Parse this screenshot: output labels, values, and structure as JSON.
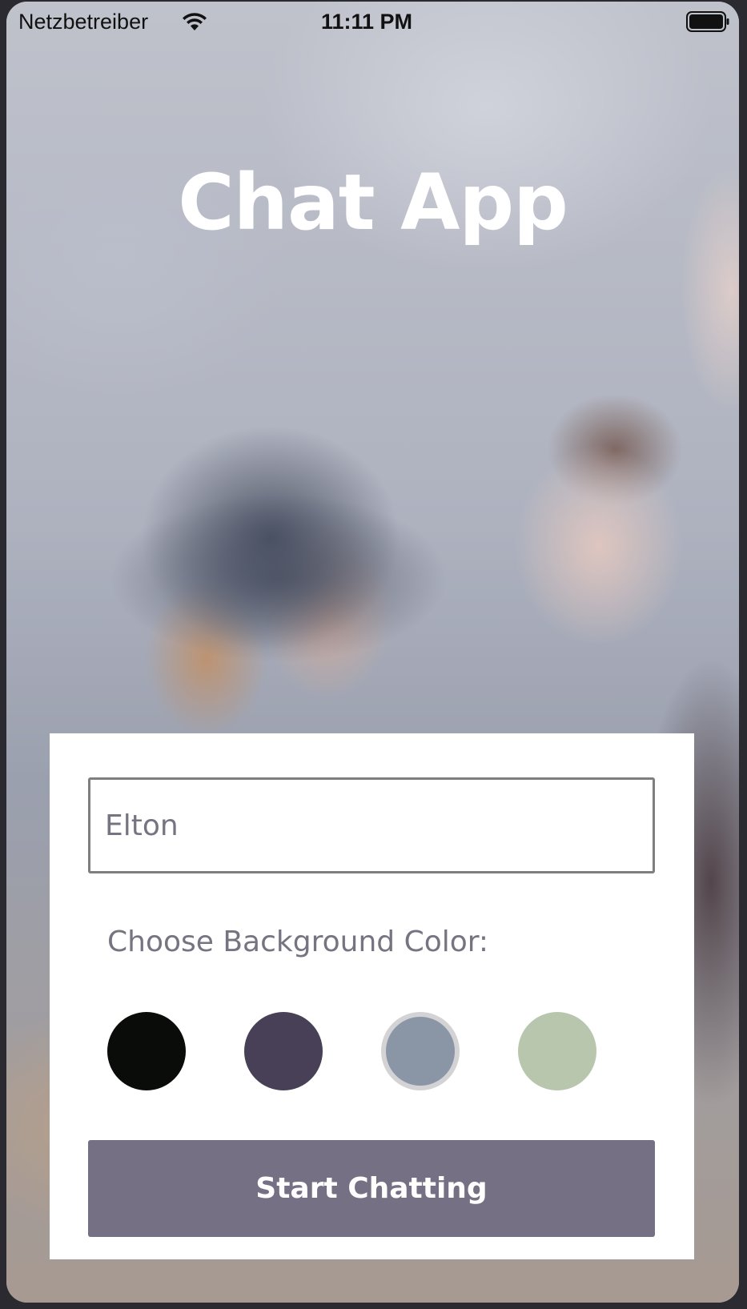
{
  "status_bar": {
    "carrier": "Netzbetreiber",
    "time": "11:11 PM",
    "wifi_icon": "wifi-icon",
    "battery_icon": "battery-icon"
  },
  "app": {
    "title": "Chat App"
  },
  "form": {
    "name_value": "Elton",
    "color_label": "Choose Background Color:",
    "colors": [
      "#090C08",
      "#474056",
      "#8A95A5",
      "#B9C6AE"
    ],
    "selected_color": "#8A95A5",
    "button_label": "Start Chatting",
    "button_color": "#757083"
  }
}
